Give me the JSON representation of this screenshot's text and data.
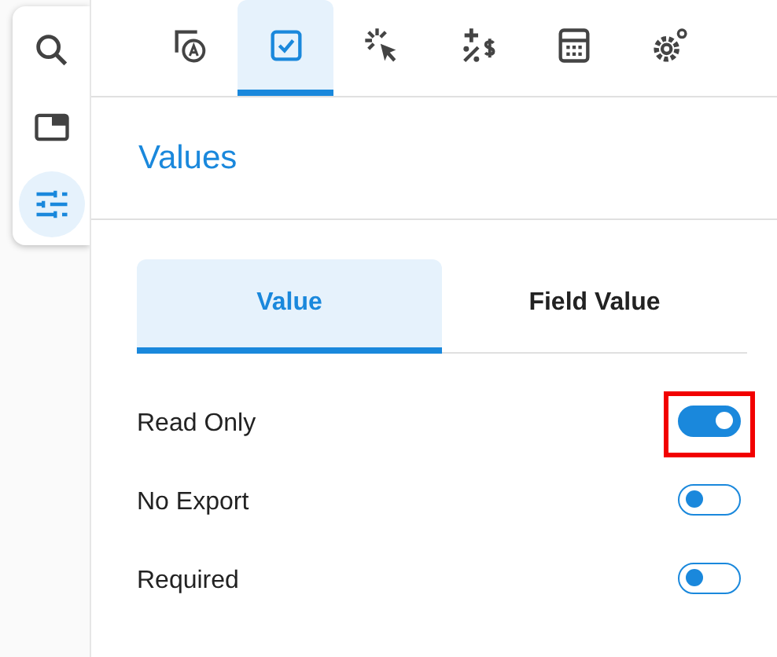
{
  "rail": [
    {
      "kind": "search",
      "selected": false
    },
    {
      "kind": "window",
      "selected": false
    },
    {
      "kind": "tune",
      "selected": true
    }
  ],
  "icon_tabs": [
    {
      "kind": "text-field",
      "selected": false
    },
    {
      "kind": "checkbox",
      "selected": true
    },
    {
      "kind": "click",
      "selected": false
    },
    {
      "kind": "math",
      "selected": false
    },
    {
      "kind": "calculator",
      "selected": false
    },
    {
      "kind": "settings",
      "selected": false
    }
  ],
  "section_title": "Values",
  "sub_tabs": [
    {
      "label": "Value",
      "selected": true
    },
    {
      "label": "Field Value",
      "selected": false
    }
  ],
  "toggles": [
    {
      "label": "Read Only",
      "on": true,
      "highlighted": true
    },
    {
      "label": "No Export",
      "on": false,
      "highlighted": false
    },
    {
      "label": "Required",
      "on": false,
      "highlighted": false
    }
  ]
}
